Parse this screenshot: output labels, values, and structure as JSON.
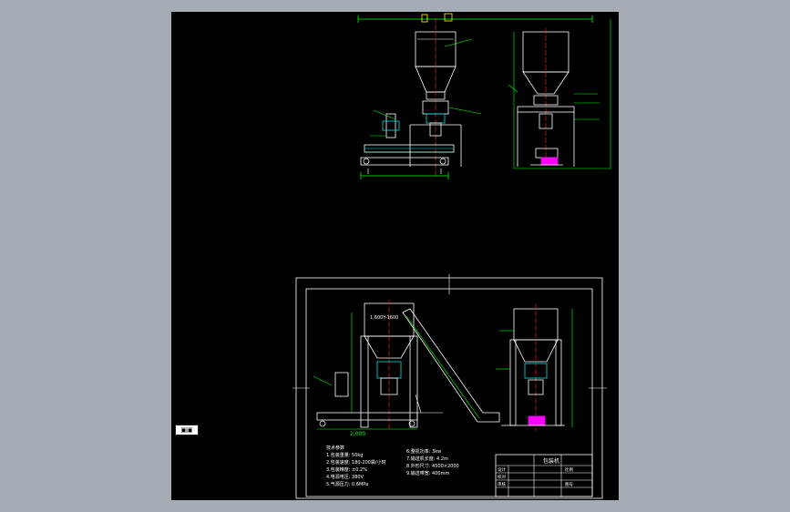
{
  "colors": {
    "background_outer": "#a5abb3",
    "canvas": "#000000",
    "outline": "#ffffff",
    "dimension": "#00ff00",
    "axis": "#ff2a2a",
    "detail": "#00e0e0",
    "highlight": "#ff00ff",
    "annotation": "#ffff00"
  },
  "side_tab": {
    "label": "▣▣"
  },
  "bottom_drawing": {
    "dimension_left": "2,000",
    "hopper_label": "1,600Y-1600",
    "notes_left": [
      "技术参数",
      "1.包装重量: 50kg",
      "2.包装速度: 180-200袋/小时",
      "3.包装精度: ±0.2%",
      "4.电源电压: 380V",
      "5.气源压力: 0.6MPa"
    ],
    "notes_right": [
      "6.整机功率: 3kw",
      "7.输送机长度: 4.2m",
      "8.外形尺寸: 4500×2000",
      "9.输送带宽: 400mm"
    ],
    "title_block": {
      "title": "包装机",
      "cells": [
        "设计",
        "校对",
        "审核",
        "比例",
        "图号"
      ]
    }
  }
}
